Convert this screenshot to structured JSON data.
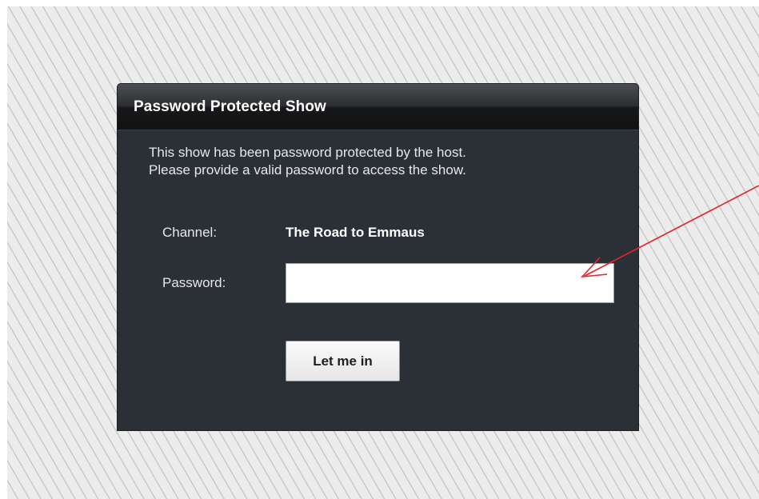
{
  "dialog": {
    "title": "Password Protected Show",
    "message_line1": "This show has been password protected by the host.",
    "message_line2": "Please provide a valid password to access the show."
  },
  "form": {
    "channel_label": "Channel:",
    "channel_value": "The Road to Emmaus",
    "password_label": "Password:",
    "password_value": "",
    "submit_label": "Let me in"
  },
  "colors": {
    "dialog_background": "#2b2f36",
    "header_background": "#1a1b1d",
    "annotation_arrow": "#e3242b",
    "page_background": "#ececec",
    "stripe": "#c7c7c7"
  },
  "icons": {
    "annotation": "red-arrow-pointing-at-password-field"
  }
}
